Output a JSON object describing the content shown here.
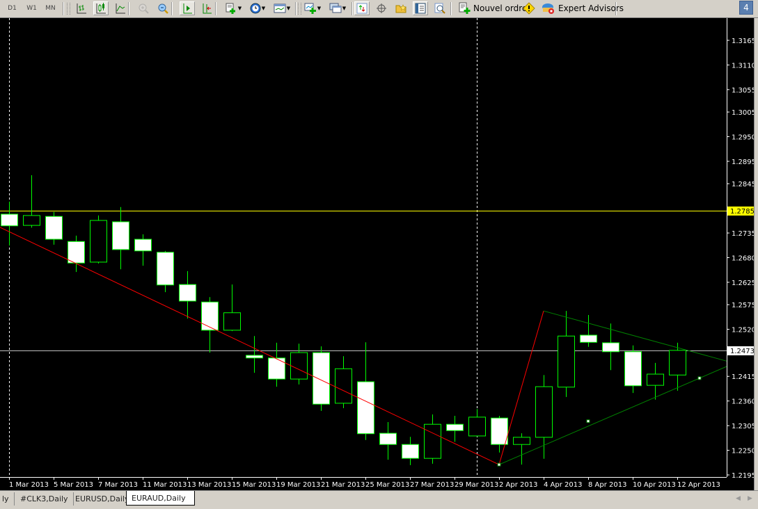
{
  "toolbar": {
    "periods": [
      {
        "label": "D1",
        "active": true
      },
      {
        "label": "W1",
        "active": false
      },
      {
        "label": "MN",
        "active": false
      }
    ],
    "icons": [
      "bar-chart-icon",
      "candlestick-chart-icon",
      "line-chart-icon",
      "zoom-in-icon",
      "zoom-out-icon",
      "auto-scroll-icon",
      "chart-shift-icon",
      "new-chart-icon",
      "periodicity-icon",
      "templates-icon",
      "indicators-icon",
      "windows-icon",
      "market-watch-icon",
      "crosshair-icon",
      "navigator-icon",
      "data-window-icon",
      "strategy-tester-icon"
    ],
    "new_order_label": "Nouvel ordre",
    "expert_advisors_label": "Expert Advisors",
    "notification_count": "4"
  },
  "tabs": [
    {
      "label": "ly",
      "active": false
    },
    {
      "label": "#CLK3,Daily",
      "active": false
    },
    {
      "label": "EURUSD,Daily",
      "active": false
    },
    {
      "label": "EURAUD,Daily",
      "active": true
    }
  ],
  "colors": {
    "background": "#000000",
    "candle_outline": "#00ff00",
    "bear_body": "#ffffff",
    "bull_body": "#000000",
    "trendline_red": "#ff0000",
    "triangle_green": "#008000",
    "ask_line": "#ffff00",
    "bid_line": "#c0c0c0",
    "axis": "#ffffff"
  },
  "chart_data": {
    "type": "candlestick",
    "ylim": [
      1.2195,
      1.3165
    ],
    "grid": false,
    "y_ticks": [
      "1.3165",
      "1.3110",
      "1.3055",
      "1.3005",
      "1.2950",
      "1.2895",
      "1.2845",
      "1.2735",
      "1.2680",
      "1.2625",
      "1.2575",
      "1.2520",
      "1.2415",
      "1.2360",
      "1.2305",
      "1.2250",
      "1.2195"
    ],
    "x_tick_labels": [
      "1 Mar 2013",
      "5 Mar 2013",
      "7 Mar 2013",
      "11 Mar 2013",
      "13 Mar 2013",
      "15 Mar 2013",
      "19 Mar 2013",
      "21 Mar 2013",
      "25 Mar 2013",
      "27 Mar 2013",
      "29 Mar 2013",
      "2 Apr 2013",
      "4 Apr 2013",
      "8 Apr 2013",
      "10 Apr 2013",
      "12 Apr 2013"
    ],
    "period_separators": [
      "1 Mar 2013",
      "1 Apr 2013"
    ],
    "dates": [
      "1 Mar 2013",
      "4 Mar 2013",
      "5 Mar 2013",
      "6 Mar 2013",
      "7 Mar 2013",
      "8 Mar 2013",
      "11 Mar 2013",
      "12 Mar 2013",
      "13 Mar 2013",
      "14 Mar 2013",
      "15 Mar 2013",
      "18 Mar 2013",
      "19 Mar 2013",
      "20 Mar 2013",
      "21 Mar 2013",
      "22 Mar 2013",
      "25 Mar 2013",
      "26 Mar 2013",
      "27 Mar 2013",
      "28 Mar 2013",
      "29 Mar 2013",
      "1 Apr 2013",
      "2 Apr 2013",
      "3 Apr 2013",
      "4 Apr 2013",
      "5 Apr 2013",
      "8 Apr 2013",
      "9 Apr 2013",
      "10 Apr 2013",
      "11 Apr 2013",
      "12 Apr 2013"
    ],
    "ohlc": [
      [
        1.2777,
        1.2805,
        1.2707,
        1.2751
      ],
      [
        1.2752,
        1.2864,
        1.2747,
        1.2774
      ],
      [
        1.2772,
        1.2782,
        1.2709,
        1.2721
      ],
      [
        1.2716,
        1.2729,
        1.2648,
        1.2668
      ],
      [
        1.267,
        1.2774,
        1.2667,
        1.2763
      ],
      [
        1.276,
        1.2793,
        1.2654,
        1.2698
      ],
      [
        1.2721,
        1.2732,
        1.2662,
        1.2695
      ],
      [
        1.2692,
        1.2695,
        1.2603,
        1.2619
      ],
      [
        1.262,
        1.265,
        1.2544,
        1.2583
      ],
      [
        1.2581,
        1.2592,
        1.2468,
        1.2518
      ],
      [
        1.2518,
        1.262,
        1.2516,
        1.2557
      ],
      [
        1.2462,
        1.2505,
        1.2423,
        1.2456
      ],
      [
        1.2456,
        1.249,
        1.2392,
        1.2409
      ],
      [
        1.2409,
        1.2488,
        1.2397,
        1.2468
      ],
      [
        1.2468,
        1.2482,
        1.2338,
        1.2353
      ],
      [
        1.2355,
        1.246,
        1.2344,
        1.2432
      ],
      [
        1.2403,
        1.2491,
        1.2273,
        1.2287
      ],
      [
        1.2288,
        1.2313,
        1.2229,
        1.2263
      ],
      [
        1.2263,
        1.228,
        1.2217,
        1.2232
      ],
      [
        1.2232,
        1.233,
        1.222,
        1.2308
      ],
      [
        1.2308,
        1.2327,
        1.2269,
        1.2294
      ],
      [
        1.2282,
        1.2342,
        1.2281,
        1.2324
      ],
      [
        1.2322,
        1.2327,
        1.2245,
        1.2263
      ],
      [
        1.2263,
        1.2288,
        1.2218,
        1.2279
      ],
      [
        1.2279,
        1.2418,
        1.2231,
        1.2392
      ],
      [
        1.2391,
        1.2561,
        1.2369,
        1.2505
      ],
      [
        1.2507,
        1.2552,
        1.2481,
        1.2491
      ],
      [
        1.249,
        1.2533,
        1.2429,
        1.247
      ],
      [
        1.247,
        1.2484,
        1.2378,
        1.2394
      ],
      [
        1.2395,
        1.2445,
        1.2363,
        1.242
      ],
      [
        1.2418,
        1.249,
        1.2383,
        1.2473
      ]
    ],
    "horizontal_lines": [
      {
        "price": 1.2785,
        "label": "1.2785",
        "color": "#ffff00",
        "label_bg": "#ffff00"
      },
      {
        "price": 1.2473,
        "label": "1.2473",
        "color": "#c0c0c0",
        "label_bg": "#ffffff"
      }
    ],
    "trendlines": [
      {
        "color": "#ff0000",
        "points": [
          [
            "1 Mar 2013",
            1.2738
          ],
          [
            "2 Apr 2013",
            1.2218
          ]
        ],
        "extend": "left"
      },
      {
        "color": "#ff0000",
        "points": [
          [
            "2 Apr 2013",
            1.2218
          ],
          [
            "4 Apr 2013",
            1.2561
          ]
        ],
        "extend": "none"
      },
      {
        "color": "#008000",
        "points": [
          [
            "4 Apr 2013",
            1.2561
          ],
          [
            "16 Apr 2013",
            1.2452
          ]
        ],
        "extend": "right"
      },
      {
        "color": "#008000",
        "points": [
          [
            "2 Apr 2013",
            1.2218
          ],
          [
            "15 Apr 2013",
            1.2411
          ]
        ],
        "extend": "right"
      }
    ],
    "anchor_points": [
      [
        "2 Apr 2013",
        1.2218
      ],
      [
        "8 Apr 2013",
        1.2315
      ],
      [
        "15 Apr 2013",
        1.2411
      ]
    ]
  }
}
